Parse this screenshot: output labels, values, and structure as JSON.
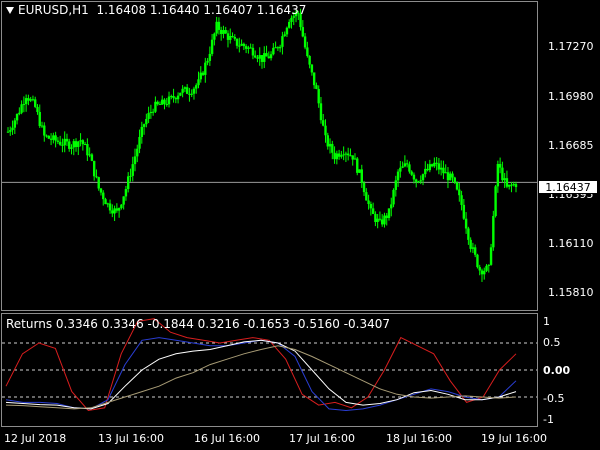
{
  "chart": {
    "symbol": "EURUSD,H1",
    "ohlc": "1.16408 1.16440 1.16407 1.16437",
    "current_price": "1.16437",
    "price_ticks": [
      "1.17270",
      "1.16980",
      "1.16685",
      "1.16395",
      "1.16110",
      "1.15810"
    ],
    "time_ticks": [
      "12 Jul 2018",
      "13 Jul 16:00",
      "16 Jul 16:00",
      "17 Jul 16:00",
      "18 Jul 16:00",
      "19 Jul 16:00"
    ],
    "candle_color": "#00ff00",
    "grid_color": "#8c8c8c"
  },
  "indicator": {
    "name": "Returns",
    "values": "0.3346 0.3346 -0.1844 0.3216 -0.1653 -0.5160 -0.3407",
    "ticks": [
      "1",
      "0.5",
      "0.00",
      "-0.5",
      "-1"
    ],
    "colors": {
      "red": "#d81e1e",
      "blue": "#2a3ed4",
      "white": "#ffffff",
      "tan": "#a89c76"
    }
  },
  "chart_data": [
    {
      "type": "line",
      "title": "EURUSD,H1",
      "subtitle": "1.16408 1.16440 1.16407 1.16437",
      "xlabel": "",
      "ylabel": "",
      "x_ticks": [
        "12 Jul 2018",
        "13 Jul 16:00",
        "16 Jul 16:00",
        "17 Jul 16:00",
        "18 Jul 16:00",
        "19 Jul 16:00"
      ],
      "ylim": [
        1.1565,
        1.1755
      ],
      "series": [
        {
          "values": [
            1.1675,
            1.1685,
            1.1698,
            1.169,
            1.1672,
            1.167,
            1.1668,
            1.1667,
            1.167,
            1.166,
            1.164,
            1.163,
            1.1625,
            1.164,
            1.166,
            1.168,
            1.169,
            1.1692,
            1.1695,
            1.17,
            1.17,
            1.1705,
            1.172,
            1.174,
            1.1735,
            1.173,
            1.1728,
            1.1725,
            1.172,
            1.1722,
            1.173,
            1.1745,
            1.1748,
            1.172,
            1.17,
            1.167,
            1.166,
            1.1664,
            1.166,
            1.1645,
            1.1625,
            1.1618,
            1.1625,
            1.165,
            1.1655,
            1.1645,
            1.165,
            1.1655,
            1.165,
            1.1645,
            1.163,
            1.1605,
            1.159,
            1.159,
            1.1655,
            1.164,
            1.1643
          ]
        }
      ]
    },
    {
      "type": "line",
      "title": "Returns",
      "subtitle": "0.3346 0.3346 -0.1844 0.3216 -0.1653 -0.5160 -0.3407",
      "xlabel": "",
      "ylabel": "",
      "ylim": [
        -1.0,
        1.0
      ],
      "series": [
        {
          "values": [
            -0.3,
            0.3,
            0.5,
            0.4,
            -0.4,
            -0.75,
            -0.7,
            0.3,
            0.9,
            0.95,
            0.7,
            0.6,
            0.55,
            0.5,
            0.55,
            0.6,
            0.55,
            0.2,
            -0.45,
            -0.65,
            -0.6,
            -0.7,
            -0.5,
            0.0,
            0.6,
            0.45,
            0.3,
            -0.2,
            -0.6,
            -0.5,
            0.0,
            0.3
          ]
        },
        {
          "values": [
            -0.55,
            -0.6,
            -0.6,
            -0.62,
            -0.7,
            -0.72,
            -0.55,
            0.1,
            0.55,
            0.6,
            0.55,
            0.5,
            0.45,
            0.45,
            0.5,
            0.55,
            0.5,
            0.25,
            -0.4,
            -0.72,
            -0.75,
            -0.72,
            -0.65,
            -0.55,
            -0.45,
            -0.35,
            -0.4,
            -0.5,
            -0.55,
            -0.5,
            -0.2
          ]
        },
        {
          "values": [
            -0.6,
            -0.62,
            -0.64,
            -0.65,
            -0.7,
            -0.72,
            -0.62,
            -0.3,
            0.0,
            0.2,
            0.3,
            0.35,
            0.38,
            0.45,
            0.52,
            0.55,
            0.5,
            0.35,
            0.0,
            -0.35,
            -0.6,
            -0.65,
            -0.62,
            -0.55,
            -0.42,
            -0.38,
            -0.45,
            -0.55,
            -0.55,
            -0.5,
            -0.4
          ]
        },
        {
          "values": [
            -0.65,
            -0.66,
            -0.68,
            -0.7,
            -0.72,
            -0.7,
            -0.6,
            -0.5,
            -0.4,
            -0.3,
            -0.15,
            -0.05,
            0.1,
            0.2,
            0.3,
            0.38,
            0.45,
            0.38,
            0.25,
            0.1,
            -0.05,
            -0.2,
            -0.35,
            -0.45,
            -0.5,
            -0.52,
            -0.5,
            -0.48,
            -0.5,
            -0.52,
            -0.5
          ]
        }
      ]
    }
  ]
}
